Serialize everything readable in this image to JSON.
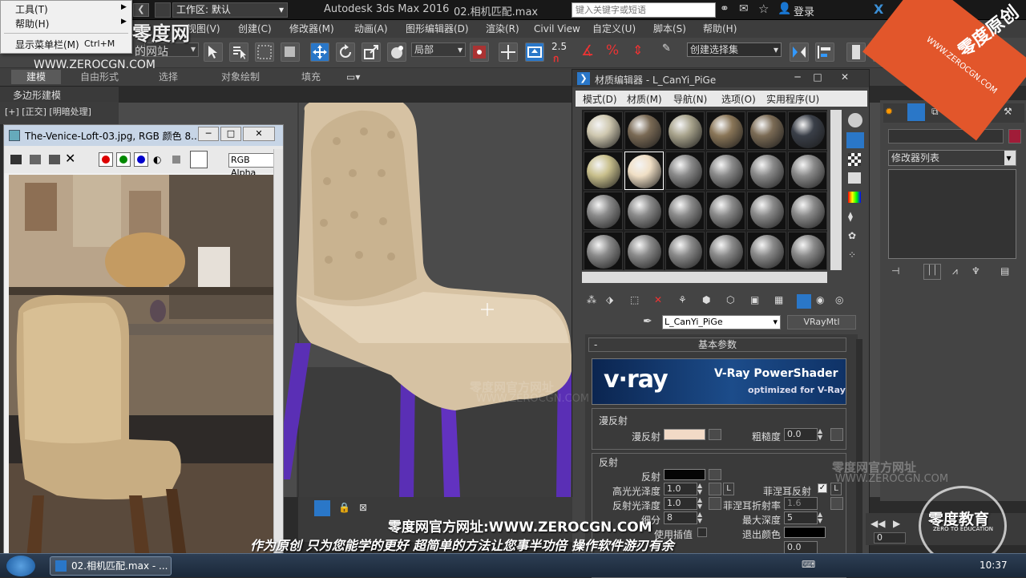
{
  "titlebar": {
    "workspace_label": "工作区: 默认",
    "app_title": "Autodesk 3ds Max 2016",
    "file_title": "02.相机匹配.max",
    "search_placeholder": "键入关键字或短语",
    "login_label": "登录",
    "watermark_lines": [
      "零度网",
      "的网站",
      "WWW.ZEROCGN.COM"
    ]
  },
  "context_menu": {
    "items": [
      {
        "label": "工具(T)"
      },
      {
        "label": "帮助(H)"
      },
      {
        "label": "显示菜单栏(M)",
        "shortcut": "Ctrl+M"
      }
    ]
  },
  "menubar": {
    "items": [
      "视图(V)",
      "创建(C)",
      "修改器(M)",
      "动画(A)",
      "图形编辑器(D)",
      "渲染(R)",
      "Civil View",
      "自定义(U)",
      "脚本(S)",
      "帮助(H)"
    ]
  },
  "toolbar": {
    "ref_coord": "局部",
    "snap_value": "2.5",
    "selection_set": "创建选择集"
  },
  "ribbon": {
    "tabs": [
      "建模",
      "自由形式",
      "选择",
      "对象绘制",
      "填充"
    ],
    "sub_label": "多边形建模"
  },
  "viewport": {
    "label": "[+] [正交] [明暗处理]"
  },
  "image_window": {
    "title": "The-Venice-Loft-03.jpg, RGB 颜色 8...",
    "channel_select": "RGB Alpha"
  },
  "material_editor": {
    "title": "材质编辑器 - L_CanYi_PiGe",
    "menu": [
      "模式(D)",
      "材质(M)",
      "导航(N)",
      "选项(O)",
      "实用程序(U)"
    ],
    "material_name": "L_CanYi_PiGe",
    "material_type": "VRayMtl",
    "rollout_title": "基本参数",
    "banner": {
      "logo": "v·ray",
      "product": "V-Ray PowerShader",
      "tagline": "optimized for V-Ray"
    },
    "diffuse_group": "漫反射",
    "diffuse_label": "漫反射",
    "roughness_label": "粗糙度",
    "roughness_value": "0.0",
    "reflect_group": "反射",
    "reflect_label": "反射",
    "hilight_gloss_label": "高光光泽度",
    "hilight_gloss_value": "1.0",
    "refl_gloss_label": "反射光泽度",
    "refl_gloss_value": "1.0",
    "subdivs_label": "细分",
    "subdivs_value": "8",
    "interp_label": "使用插值",
    "fresnel_label": "菲涅耳反射",
    "fresnel_ior_label": "菲涅耳折射率",
    "fresnel_ior_value": "1.6",
    "max_depth_label": "最大深度",
    "max_depth_value": "5",
    "exit_color_label": "退出颜色",
    "dim_value": "0.0",
    "l_button": "L",
    "colors": {
      "diffuse": "#f2dac6",
      "reflect": "#050505",
      "exit": "#000000"
    }
  },
  "command_panel": {
    "modifier_list": "修改器列表"
  },
  "watermarks": {
    "site": "零度网官方网址",
    "url": "WWW.ZEROCGN.COM",
    "corner_badge": "零度原创",
    "corner_url": "WWW.ZEROCGN.COM",
    "edu_logo": "零度教育",
    "edu_sub": "ZERO TO EDUCATION"
  },
  "subtitles": {
    "line1": "零度网官方网址:WWW.ZEROCGN.COM",
    "line2": "作为原创 只为您能学的更好 超简单的方法让您事半功倍 操作软件游刃有余"
  },
  "anim": {
    "frame": "0"
  },
  "taskbar": {
    "task_label": "02.相机匹配.max - ...",
    "clock": "10:37"
  }
}
